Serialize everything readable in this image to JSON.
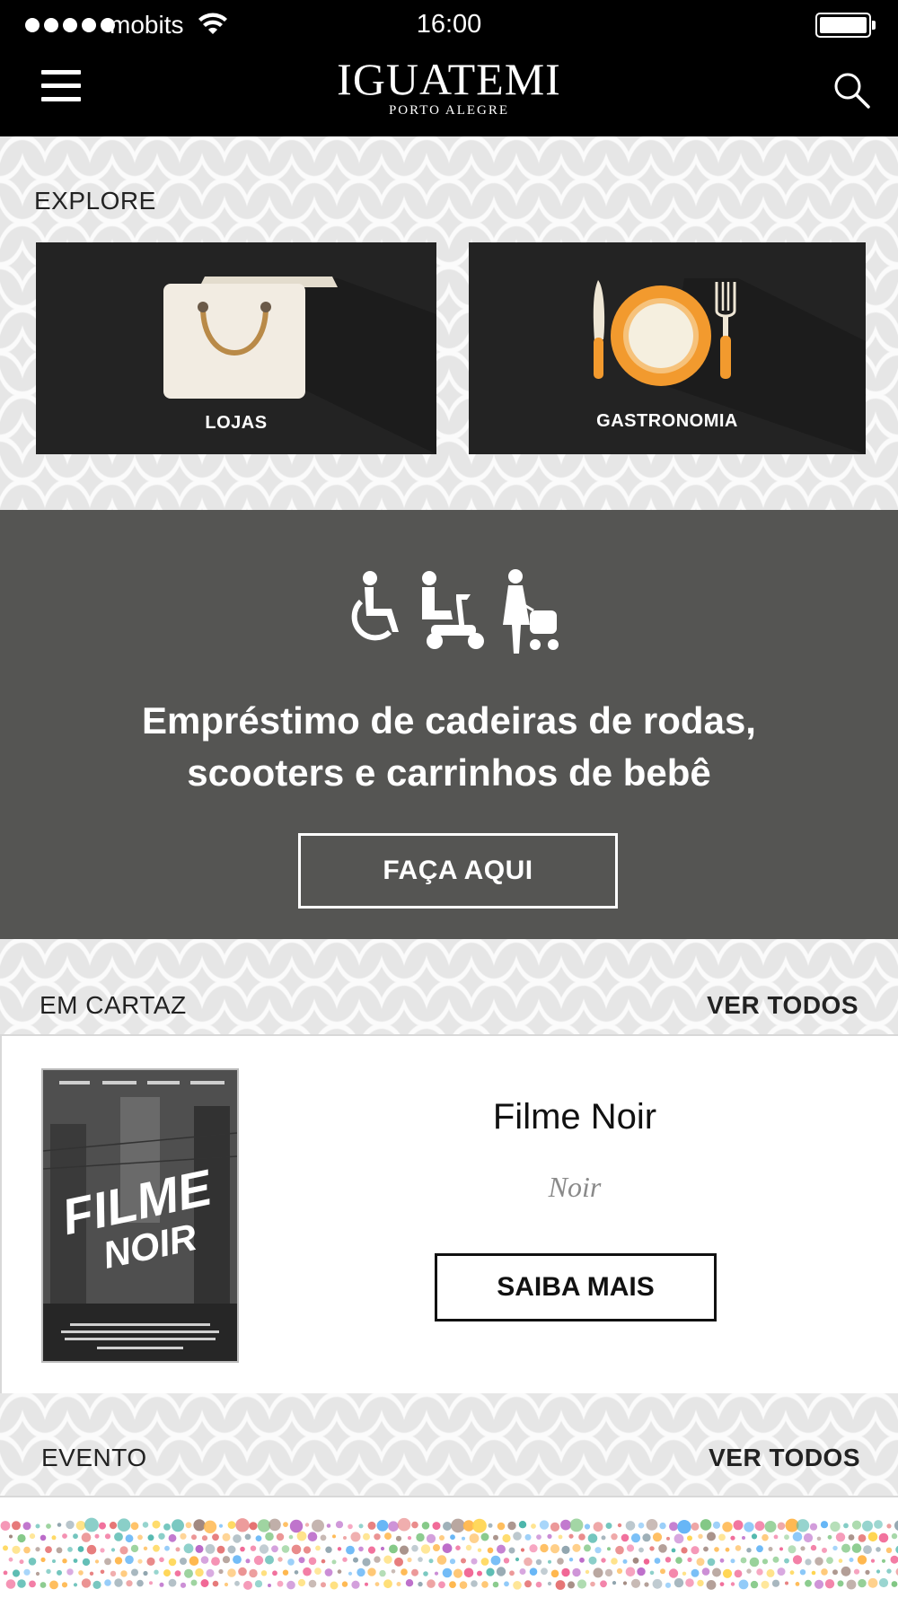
{
  "status_bar": {
    "carrier": "mobits",
    "time": "16:00"
  },
  "header": {
    "logo_main": "IGUATEMI",
    "logo_sub": "PORTO ALEGRE"
  },
  "explore": {
    "title": "EXPLORE",
    "tiles": [
      {
        "label": "LOJAS",
        "icon": "shopping-bag-icon"
      },
      {
        "label": "GASTRONOMIA",
        "icon": "plate-cutlery-icon"
      }
    ]
  },
  "accessibility_promo": {
    "icons": [
      "wheelchair-icon",
      "mobility-scooter-icon",
      "stroller-icon"
    ],
    "title_line1": "Empréstimo de cadeiras de rodas,",
    "title_line2": "scooters e carrinhos de bebê",
    "button_label": "FAÇA AQUI",
    "background_color": "#555553"
  },
  "em_cartaz": {
    "title": "EM CARTAZ",
    "see_all": "VER TODOS",
    "movie": {
      "poster_title_line1": "FILME",
      "poster_title_line2": "NOIR",
      "title": "Filme Noir",
      "genre": "Noir",
      "button_label": "SAIBA MAIS"
    }
  },
  "evento": {
    "title": "EVENTO",
    "see_all": "VER TODOS"
  },
  "colors": {
    "header_bg": "#000000",
    "tile_bg": "#232323",
    "accent_orange": "#f29a2e"
  }
}
